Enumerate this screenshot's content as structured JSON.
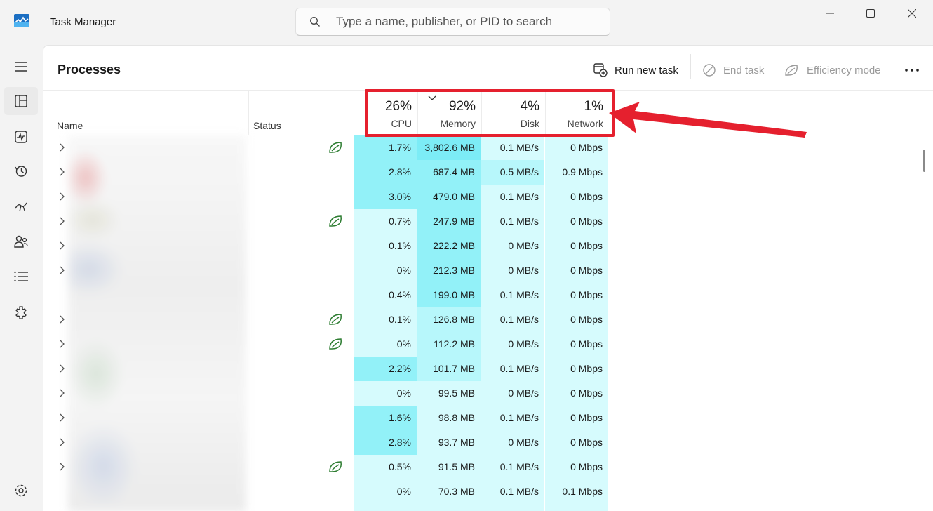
{
  "app": {
    "title": "Task Manager"
  },
  "search": {
    "placeholder": "Type a name, publisher, or PID to search"
  },
  "page": {
    "title": "Processes"
  },
  "toolbar": {
    "run_new_task": "Run new task",
    "end_task": "End task",
    "efficiency_mode": "Efficiency mode"
  },
  "columns": {
    "name": "Name",
    "status": "Status",
    "cpu": {
      "pct": "26%",
      "label": "CPU"
    },
    "memory": {
      "pct": "92%",
      "label": "Memory"
    },
    "disk": {
      "pct": "4%",
      "label": "Disk"
    },
    "network": {
      "pct": "1%",
      "label": "Network"
    }
  },
  "nav": [
    "menu-icon",
    "processes-icon",
    "performance-icon",
    "app-history-icon",
    "startup-apps-icon",
    "users-icon",
    "details-icon",
    "services-icon",
    "settings-icon"
  ],
  "colors": {
    "accent": "#0f6cbd",
    "annotation": "#e5202e",
    "efficiency_leaf": "#2e7d32"
  },
  "rows": [
    {
      "expand": true,
      "eco": true,
      "cpu": "1.7%",
      "mem": "3,802.6 MB",
      "disk": "0.1 MB/s",
      "net": "0 Mbps",
      "h": [
        3,
        4,
        1,
        1
      ]
    },
    {
      "expand": true,
      "eco": false,
      "cpu": "2.8%",
      "mem": "687.4 MB",
      "disk": "0.5 MB/s",
      "net": "0.9 Mbps",
      "h": [
        3,
        3,
        2,
        1
      ]
    },
    {
      "expand": true,
      "eco": false,
      "cpu": "3.0%",
      "mem": "479.0 MB",
      "disk": "0.1 MB/s",
      "net": "0 Mbps",
      "h": [
        3,
        3,
        1,
        1
      ]
    },
    {
      "expand": true,
      "eco": true,
      "cpu": "0.7%",
      "mem": "247.9 MB",
      "disk": "0.1 MB/s",
      "net": "0 Mbps",
      "h": [
        1,
        3,
        1,
        1
      ]
    },
    {
      "expand": true,
      "eco": false,
      "cpu": "0.1%",
      "mem": "222.2 MB",
      "disk": "0 MB/s",
      "net": "0 Mbps",
      "h": [
        1,
        3,
        1,
        1
      ]
    },
    {
      "expand": true,
      "eco": false,
      "cpu": "0%",
      "mem": "212.3 MB",
      "disk": "0 MB/s",
      "net": "0 Mbps",
      "h": [
        1,
        3,
        1,
        1
      ]
    },
    {
      "expand": false,
      "eco": false,
      "cpu": "0.4%",
      "mem": "199.0 MB",
      "disk": "0.1 MB/s",
      "net": "0 Mbps",
      "h": [
        1,
        3,
        1,
        1
      ]
    },
    {
      "expand": true,
      "eco": true,
      "cpu": "0.1%",
      "mem": "126.8 MB",
      "disk": "0.1 MB/s",
      "net": "0 Mbps",
      "h": [
        1,
        2,
        1,
        1
      ]
    },
    {
      "expand": true,
      "eco": true,
      "cpu": "0%",
      "mem": "112.2 MB",
      "disk": "0 MB/s",
      "net": "0 Mbps",
      "h": [
        1,
        2,
        1,
        1
      ]
    },
    {
      "expand": true,
      "eco": false,
      "cpu": "2.2%",
      "mem": "101.7 MB",
      "disk": "0.1 MB/s",
      "net": "0 Mbps",
      "h": [
        3,
        2,
        1,
        1
      ]
    },
    {
      "expand": true,
      "eco": false,
      "cpu": "0%",
      "mem": "99.5 MB",
      "disk": "0 MB/s",
      "net": "0 Mbps",
      "h": [
        1,
        1,
        1,
        1
      ]
    },
    {
      "expand": true,
      "eco": false,
      "cpu": "1.6%",
      "mem": "98.8 MB",
      "disk": "0.1 MB/s",
      "net": "0 Mbps",
      "h": [
        3,
        1,
        1,
        1
      ]
    },
    {
      "expand": true,
      "eco": false,
      "cpu": "2.8%",
      "mem": "93.7 MB",
      "disk": "0 MB/s",
      "net": "0 Mbps",
      "h": [
        3,
        1,
        1,
        1
      ]
    },
    {
      "expand": true,
      "eco": true,
      "cpu": "0.5%",
      "mem": "91.5 MB",
      "disk": "0.1 MB/s",
      "net": "0 Mbps",
      "h": [
        1,
        1,
        1,
        1
      ]
    },
    {
      "expand": false,
      "eco": false,
      "cpu": "0%",
      "mem": "70.3 MB",
      "disk": "0.1 MB/s",
      "net": "0.1 Mbps",
      "h": [
        1,
        1,
        1,
        1
      ]
    },
    {
      "expand": false,
      "eco": false,
      "cpu": "",
      "mem": "",
      "disk": "",
      "net": "",
      "h": [
        1,
        1,
        1,
        1
      ]
    }
  ]
}
